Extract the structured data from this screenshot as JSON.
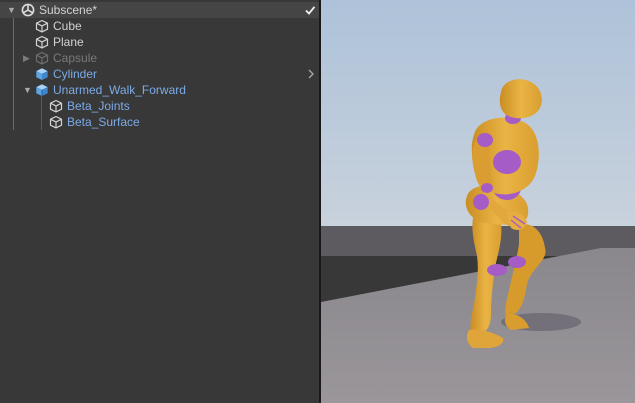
{
  "hierarchy": {
    "scene": {
      "label": "Subscene*",
      "checked": true
    },
    "items": [
      {
        "label": "Cube",
        "type": "object"
      },
      {
        "label": "Plane",
        "type": "object"
      },
      {
        "label": "Capsule",
        "type": "disabled"
      },
      {
        "label": "Cylinder",
        "type": "prefab"
      },
      {
        "label": "Unarmed_Walk_Forward",
        "type": "prefab"
      },
      {
        "label": "Beta_Joints",
        "type": "prefab-child"
      },
      {
        "label": "Beta_Surface",
        "type": "prefab-child"
      }
    ]
  },
  "colors": {
    "panel_bg": "#383838",
    "header_bg": "#454545",
    "text": "#d2d2d2",
    "prefab_text": "#7babe6",
    "disabled_text": "#7a7a7a",
    "character_body": "#e8ac3c",
    "character_joints": "#a55cc6",
    "sky_top": "#b7c9dd",
    "ground": "#8d8a90"
  },
  "viewport": {
    "content": "3D character in walk pose (Beta_Surface / Beta_Joints) on grey plane"
  }
}
